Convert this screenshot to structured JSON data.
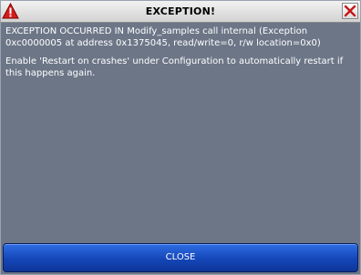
{
  "window": {
    "title": "EXCEPTION!"
  },
  "icons": {
    "title_icon": "warning-icon",
    "close_icon": "close-icon"
  },
  "colors": {
    "dialog_background": "#6c7687",
    "button_background": "#1546b8",
    "warning_red": "#d81b1b",
    "close_x_red": "#c81616"
  },
  "message": {
    "line1": "EXCEPTION OCCURRED IN Modify_samples call internal (Exception 0xc0000005 at address 0x1375045, read/write=0, r/w location=0x0)",
    "line2": "Enable 'Restart on crashes' under Configuration to automatically restart if this happens again."
  },
  "buttons": {
    "close_label": "CLOSE"
  }
}
